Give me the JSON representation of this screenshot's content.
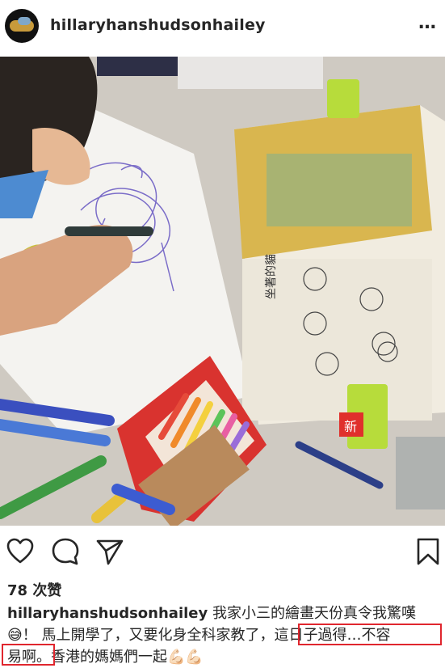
{
  "header": {
    "username": "hillaryhanshudsonhailey",
    "more_icon": "…"
  },
  "photo": {
    "book_title": "坐著的貓",
    "book_badge": "新"
  },
  "actions": {
    "icons": [
      "heart-icon",
      "comment-icon",
      "share-icon",
      "bookmark-icon"
    ]
  },
  "likes": {
    "text": "78 次赞"
  },
  "caption": {
    "username": "hillaryhanshudsonhailey",
    "line1": "我家小三的繪畫天份真令我驚嘆",
    "emoji1": "😅",
    "line2a": "！ 馬上開學了，又要化身全科家教了，",
    "line2b": "這日子過得…不容",
    "line3a": "易啊。",
    "line3b": "香港的媽媽們一起",
    "emoji2": "💪🏻💪🏻"
  },
  "colors": {
    "highlight": "#e0262e",
    "text": "#262626"
  }
}
